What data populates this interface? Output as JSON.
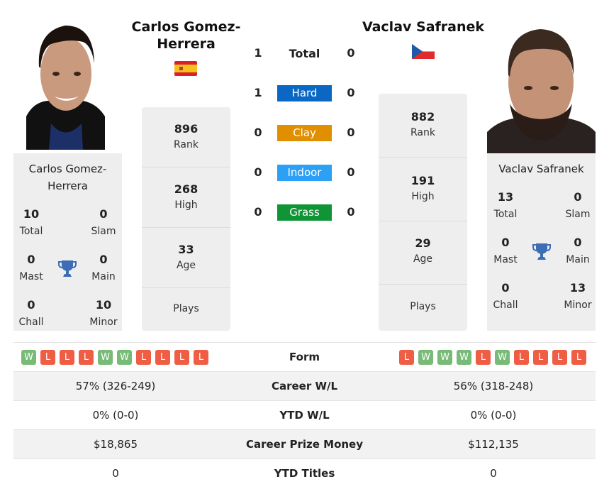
{
  "colors": {
    "hard": "#0a68c4",
    "clay": "#e08f00",
    "indoor": "#2ba0f4",
    "grass": "#0f9535",
    "win": "#77bb77",
    "loss": "#ee5d44",
    "trophy": "#3c6db5"
  },
  "player1": {
    "name": "Carlos Gomez-Herrera",
    "card_name": "Carlos Gomez-Herrera",
    "flag": "spain-flag",
    "titles": {
      "total": {
        "value": "10",
        "label": "Total"
      },
      "slam": {
        "value": "0",
        "label": "Slam"
      },
      "mast": {
        "value": "0",
        "label": "Mast"
      },
      "main": {
        "value": "0",
        "label": "Main"
      },
      "chall": {
        "value": "0",
        "label": "Chall"
      },
      "minor": {
        "value": "10",
        "label": "Minor"
      }
    },
    "rank": {
      "value": "896",
      "label": "Rank"
    },
    "high": {
      "value": "268",
      "label": "High"
    },
    "age": {
      "value": "33",
      "label": "Age"
    },
    "plays": {
      "value": "",
      "label": "Plays"
    },
    "form": [
      "W",
      "L",
      "L",
      "L",
      "W",
      "W",
      "L",
      "L",
      "L",
      "L"
    ]
  },
  "player2": {
    "name": "Vaclav Safranek",
    "card_name": "Vaclav Safranek",
    "flag": "czech-flag",
    "titles": {
      "total": {
        "value": "13",
        "label": "Total"
      },
      "slam": {
        "value": "0",
        "label": "Slam"
      },
      "mast": {
        "value": "0",
        "label": "Mast"
      },
      "main": {
        "value": "0",
        "label": "Main"
      },
      "chall": {
        "value": "0",
        "label": "Chall"
      },
      "minor": {
        "value": "13",
        "label": "Minor"
      }
    },
    "rank": {
      "value": "882",
      "label": "Rank"
    },
    "high": {
      "value": "191",
      "label": "High"
    },
    "age": {
      "value": "29",
      "label": "Age"
    },
    "plays": {
      "value": "",
      "label": "Plays"
    },
    "form": [
      "L",
      "W",
      "W",
      "W",
      "L",
      "W",
      "L",
      "L",
      "L",
      "L"
    ]
  },
  "h2h": [
    {
      "label": "Total",
      "p1": "1",
      "p2": "0",
      "surface": "total"
    },
    {
      "label": "Hard",
      "p1": "1",
      "p2": "0",
      "surface": "hard"
    },
    {
      "label": "Clay",
      "p1": "0",
      "p2": "0",
      "surface": "clay"
    },
    {
      "label": "Indoor",
      "p1": "0",
      "p2": "0",
      "surface": "indoor"
    },
    {
      "label": "Grass",
      "p1": "0",
      "p2": "0",
      "surface": "grass"
    }
  ],
  "table": {
    "form_label": "Form",
    "rows": [
      {
        "label": "Career W/L",
        "p1": "57% (326-249)",
        "p2": "56% (318-248)"
      },
      {
        "label": "YTD W/L",
        "p1": "0% (0-0)",
        "p2": "0% (0-0)"
      },
      {
        "label": "Career Prize Money",
        "p1": "$18,865",
        "p2": "$112,135"
      },
      {
        "label": "YTD Titles",
        "p1": "0",
        "p2": "0"
      }
    ]
  }
}
